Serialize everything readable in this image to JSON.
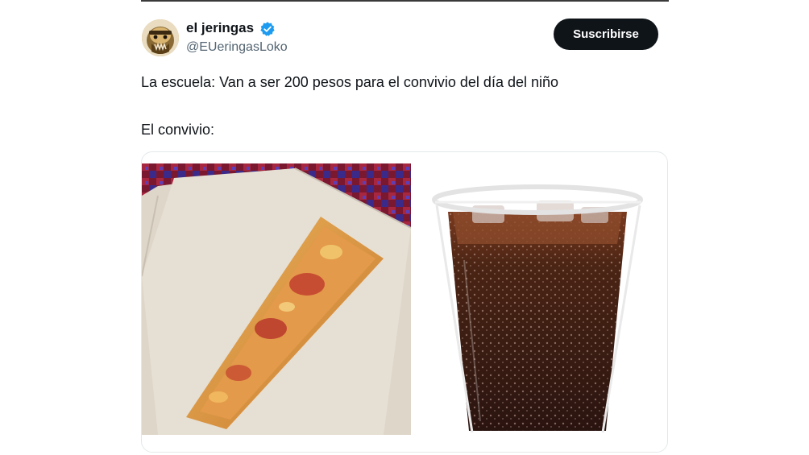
{
  "tweet": {
    "author": {
      "display_name": "el jeringas",
      "handle": "@EUeringasLoko",
      "verified": true,
      "verified_icon": "verified-badge-icon",
      "verified_color": "#1d9bf0"
    },
    "subscribe_label": "Suscribirse",
    "text_line_1": "La escuela: Van a ser 200 pesos para el convivio del día del niño",
    "text_line_2": "El convivio:",
    "media": [
      {
        "name": "pizza-slice-photo"
      },
      {
        "name": "soda-cup-photo"
      }
    ]
  },
  "colors": {
    "text": "#0f1419",
    "secondary_text": "#536471",
    "button_bg": "#0f1419",
    "button_text": "#ffffff"
  }
}
